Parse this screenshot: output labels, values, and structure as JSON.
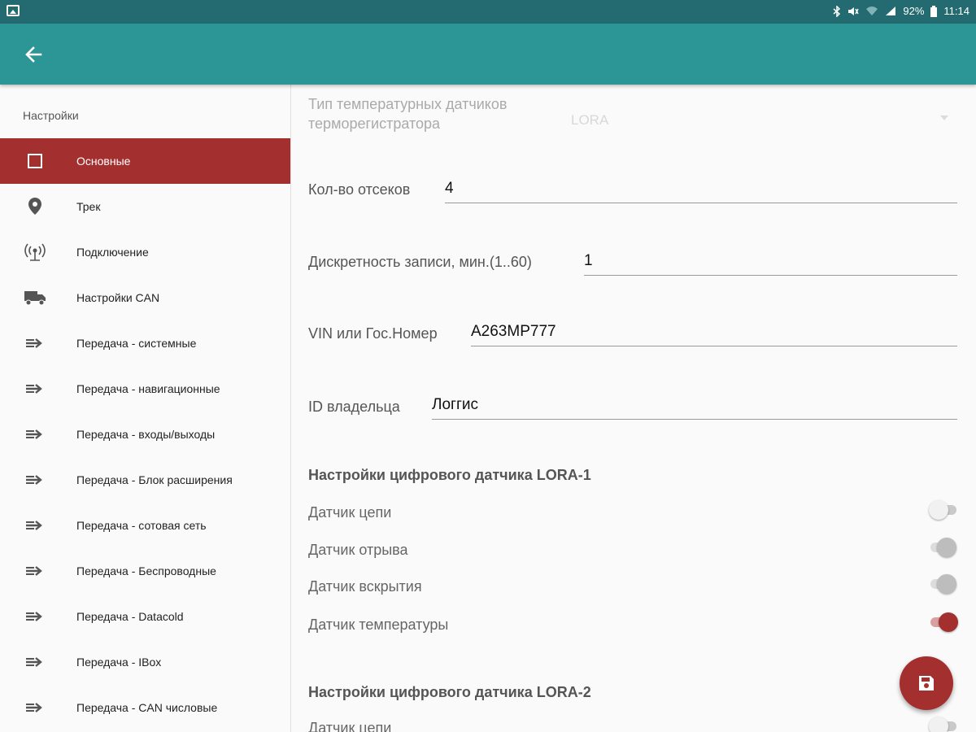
{
  "status_bar": {
    "battery": "92%",
    "time": "11:14"
  },
  "sidebar": {
    "title": "Настройки",
    "items": [
      {
        "label": "Основные",
        "icon": "square-icon",
        "active": true
      },
      {
        "label": "Трек",
        "icon": "location-pin-icon"
      },
      {
        "label": "Подключение",
        "icon": "antenna-icon"
      },
      {
        "label": "Настройки CAN",
        "icon": "truck-icon"
      },
      {
        "label": "Передача - системные",
        "icon": "arrow-right-icon"
      },
      {
        "label": "Передача - навигационные",
        "icon": "arrow-right-icon"
      },
      {
        "label": "Передача - входы/выходы",
        "icon": "arrow-right-icon"
      },
      {
        "label": "Передача - Блок расширения",
        "icon": "arrow-right-icon"
      },
      {
        "label": "Передача - сотовая сеть",
        "icon": "arrow-right-icon"
      },
      {
        "label": "Передача - Беспроводные",
        "icon": "arrow-right-icon"
      },
      {
        "label": "Передача - Datacold",
        "icon": "arrow-right-icon"
      },
      {
        "label": "Передача - IBox",
        "icon": "arrow-right-icon"
      },
      {
        "label": "Передача - CAN числовые",
        "icon": "arrow-right-icon"
      }
    ]
  },
  "main": {
    "sensor_type": {
      "label_line1": "Тип температурных датчиков",
      "label_line2": "терморегистратора",
      "value": "LORA"
    },
    "compartments": {
      "label": "Кол-во отсеков",
      "value": "4"
    },
    "record_interval": {
      "label": "Дискретность записи, мин.(1..60)",
      "value": "1"
    },
    "vin": {
      "label": "VIN или Гос.Номер",
      "value": "А263МР777"
    },
    "owner_id": {
      "label": "ID владельца",
      "value": "Логгис"
    },
    "lora1": {
      "title": "Настройки цифрового датчика LORA-1",
      "toggles": [
        {
          "label": "Датчик цепи",
          "state": "off"
        },
        {
          "label": "Датчик отрыва",
          "state": "disabled"
        },
        {
          "label": "Датчик вскрытия",
          "state": "disabled"
        },
        {
          "label": "Датчик температуры",
          "state": "on"
        }
      ]
    },
    "lora2": {
      "title": "Настройки цифрового датчика LORA-2",
      "toggles": [
        {
          "label": "Датчик цепи",
          "state": "off"
        }
      ]
    }
  },
  "colors": {
    "status_bar": "#236b70",
    "app_bar": "#2c9696",
    "accent": "#a3302f"
  }
}
